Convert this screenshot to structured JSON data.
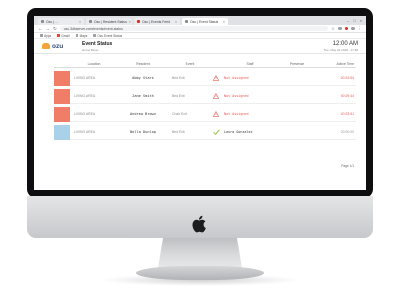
{
  "browser": {
    "tabs": [
      {
        "label": "Ozu | ...",
        "active": false,
        "favicon": "gray"
      },
      {
        "label": "Ozu | Resident Status",
        "active": false,
        "favicon": "gray"
      },
      {
        "label": "Ozu | Events Feed",
        "active": false,
        "favicon": "red"
      },
      {
        "label": "Ozu | Event Status",
        "active": true,
        "favicon": "gray"
      }
    ],
    "url": "ozu.3dbserver.com/events/event-status",
    "bookmarks": [
      "Apps",
      "Gmail",
      "Maps",
      "Ozu Event Status"
    ]
  },
  "app": {
    "logo_text": "ozu",
    "title": "Event Status",
    "subtitle": "Home Menu",
    "clock": "12:00 AM",
    "date": "Tue, May 22 2018 - 17:38"
  },
  "table": {
    "columns": [
      "Location",
      "Resident",
      "Event",
      "Staff",
      "Presence",
      "Active Time"
    ],
    "rows": [
      {
        "swatch_color": "#f07d68",
        "location": "LIVING AREA",
        "resident": "Abby Stars",
        "event": "Bed Exit",
        "status_icon": "warning-triangle-icon",
        "staff": "Not Assigned",
        "presence": "",
        "active_time": "00:31:54",
        "alert": true
      },
      {
        "swatch_color": "#f07d68",
        "location": "LIVING AREA",
        "resident": "Jane Smith",
        "event": "Bed Exit",
        "status_icon": "warning-triangle-icon",
        "staff": "Not Assigned",
        "presence": "",
        "active_time": "00:29:44",
        "alert": true
      },
      {
        "swatch_color": "#f07d68",
        "location": "LIVING AREA",
        "resident": "Andrew Brown",
        "event": "Chair Exit",
        "status_icon": "warning-triangle-icon",
        "staff": "Not Assigned",
        "presence": "",
        "active_time": "00:23:51",
        "alert": true
      },
      {
        "swatch_color": "#a9d2ea",
        "location": "LIVING AREA",
        "resident": "Bella Dunlop",
        "event": "Bed Exit",
        "status_icon": "checkmark-icon",
        "staff": "Laura Gonzalez",
        "presence": "",
        "active_time": "00:00:00",
        "alert": false
      }
    ],
    "pager": "Page 1/1"
  },
  "colors": {
    "alert_red": "#e4584f",
    "ok_green": "#8cc63f",
    "brand_orange": "#f2a33a",
    "brand_navy": "#2c4a7b"
  }
}
